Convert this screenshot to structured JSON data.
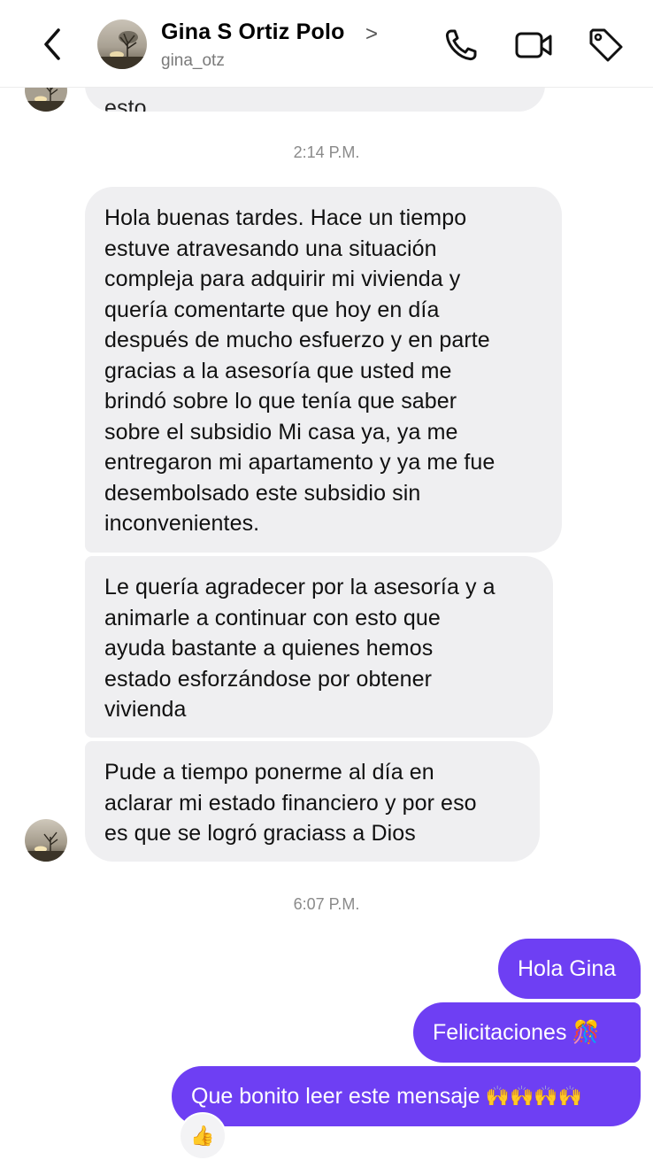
{
  "header": {
    "name": "Gina S Ortiz Polo",
    "name_chevron": ">",
    "username": "gina_otz",
    "icons": [
      "back-chevron-icon",
      "phone-icon",
      "video-camera-icon",
      "tag-icon"
    ]
  },
  "partial_top_message": "esto",
  "timestamps": [
    "2:14 P.M.",
    "6:07 P.M."
  ],
  "incoming": [
    "Hola buenas tardes. Hace un tiempo\nestuve atravesando una situación\ncompleja para adquirir mi vivienda y\nquería comentarte que hoy en día\ndespués de mucho esfuerzo y en parte\ngracias a la asesoría que usted me\nbrindó sobre lo que tenía que saber\nsobre el subsidio Mi casa ya, ya me\nentregaron mi apartamento y ya me fue\ndesembolsado este subsidio sin\ninconvenientes.",
    "Le quería agradecer por la asesoría y a\nanimarle a continuar con esto que\nayuda bastante a quienes hemos\nestado esforzándose por obtener\nvivienda",
    "Pude a tiempo ponerme al día en\naclarar mi estado financiero y por eso\nes que se logró graciass a Dios"
  ],
  "outgoing": [
    {
      "text": "Hola Gina",
      "emoji": ""
    },
    {
      "text": "Felicitaciones",
      "emoji": "🎊"
    },
    {
      "text": "Que bonito leer este mensaje",
      "emoji": "🙌🙌🙌🙌"
    }
  ],
  "reaction": "👍",
  "colors": {
    "outgoing_bubble": "#6e3ff3",
    "incoming_bubble": "#efeff1",
    "timestamp": "#8a8a8a"
  }
}
